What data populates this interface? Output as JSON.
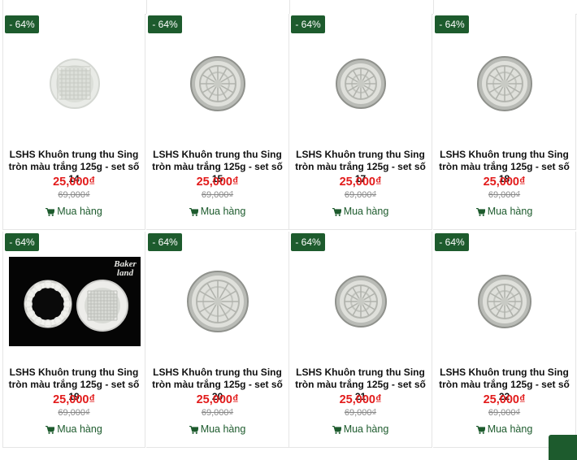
{
  "colors": {
    "badge": "#1d5b2d",
    "price": "#e21b1b",
    "buy": "#1d5b2d"
  },
  "products": [
    {
      "badge": "- 64%",
      "title": "LSHS Khuôn trung thu Sing tròn màu trắng 125g - set số 14",
      "price": "25,000₫",
      "old_price": "69,000₫",
      "buy": "Mua hàng",
      "image": "white-round-mould-small"
    },
    {
      "badge": "- 64%",
      "title": "LSHS Khuôn trung thu Sing tròn màu trắng 125g - set số 15",
      "price": "25,000₫",
      "old_price": "69,000₫",
      "buy": "Mua hàng",
      "image": "patterned-round-mould"
    },
    {
      "badge": "- 64%",
      "title": "LSHS Khuôn trung thu Sing tròn màu trắng 125g - set số 17",
      "price": "25,000₫",
      "old_price": "69,000₫",
      "buy": "Mua hàng",
      "image": "patterned-round-mould"
    },
    {
      "badge": "- 64%",
      "title": "LSHS Khuôn trung thu Sing tròn màu trắng 125g - set số 18",
      "price": "25,000₫",
      "old_price": "69,000₫",
      "buy": "Mua hàng",
      "image": "patterned-round-mould"
    },
    {
      "badge": "- 64%",
      "title": "LSHS Khuôn trung thu Sing tròn màu trắng 125g - set số 19",
      "price": "25,000₫",
      "old_price": "69,000₫",
      "buy": "Mua hàng",
      "image": "mould-photo-bakerland",
      "logo": "Baker land"
    },
    {
      "badge": "- 64%",
      "title": "LSHS Khuôn trung thu Sing tròn màu trắng 125g - set số 20",
      "price": "25,000₫",
      "old_price": "69,000₫",
      "buy": "Mua hàng",
      "image": "patterned-round-mould"
    },
    {
      "badge": "- 64%",
      "title": "LSHS Khuôn trung thu Sing tròn màu trắng 125g - set số 21",
      "price": "25,000₫",
      "old_price": "69,000₫",
      "buy": "Mua hàng",
      "image": "patterned-round-mould"
    },
    {
      "badge": "- 64%",
      "title": "LSHS Khuôn trung thu Sing tròn màu trắng 125g - set số 22",
      "price": "25,000₫",
      "old_price": "69,000₫",
      "buy": "Mua hàng",
      "image": "patterned-round-mould"
    }
  ]
}
